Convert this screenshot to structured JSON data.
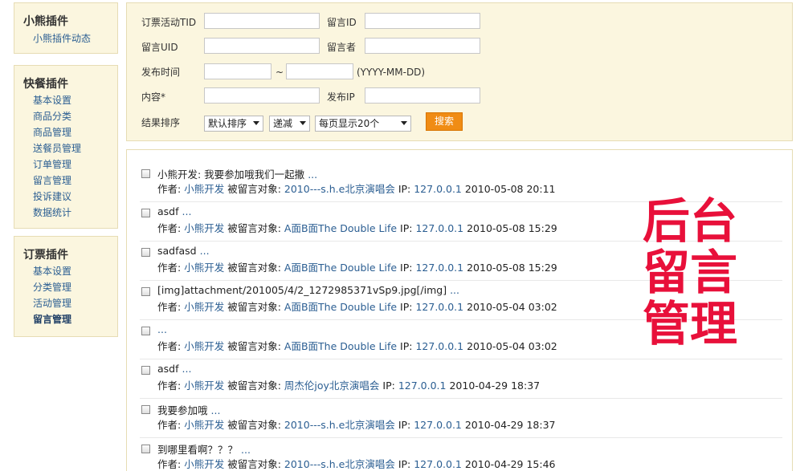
{
  "sidebar": {
    "sections": [
      {
        "title": "小熊插件",
        "items": [
          {
            "label": "小熊插件动态"
          }
        ]
      },
      {
        "title": "快餐插件",
        "items": [
          {
            "label": "基本设置"
          },
          {
            "label": "商品分类"
          },
          {
            "label": "商品管理"
          },
          {
            "label": "送餐员管理"
          },
          {
            "label": "订单管理"
          },
          {
            "label": "留言管理"
          },
          {
            "label": "投诉建议"
          },
          {
            "label": "数据统计"
          }
        ]
      },
      {
        "title": "订票插件",
        "items": [
          {
            "label": "基本设置"
          },
          {
            "label": "分类管理"
          },
          {
            "label": "活动管理"
          },
          {
            "label": "留言管理",
            "active": true
          }
        ]
      }
    ]
  },
  "filter": {
    "tid_label": "订票活动TID",
    "comment_id_label": "留言ID",
    "uid_label": "留言UID",
    "author_label": "留言者",
    "time_label": "发布时间",
    "time_sep": "~",
    "time_hint": "(YYYY-MM-DD)",
    "content_label": "内容*",
    "ip_label": "发布IP",
    "sort_label": "结果排序",
    "sort_order": "默认排序",
    "sort_dir": "递减",
    "per_page": "每页显示20个",
    "search_button": "搜索"
  },
  "list": {
    "author_prefix": "作者:",
    "target_prefix": "被留言对象:",
    "ip_prefix": "IP:",
    "rows": [
      {
        "title": "小熊开发: 我要参加哦我们一起撒",
        "author": "小熊开发",
        "target": "2010---s.h.e北京演唱会",
        "ip": "127.0.0.1",
        "time": "2010-05-08 20:11"
      },
      {
        "title": "asdf",
        "author": "小熊开发",
        "target": "A面B面The Double Life",
        "ip": "127.0.0.1",
        "time": "2010-05-08 15:29"
      },
      {
        "title": "sadfasd",
        "author": "小熊开发",
        "target": "A面B面The Double Life",
        "ip": "127.0.0.1",
        "time": "2010-05-08 15:29"
      },
      {
        "title": "[img]attachment/201005/4/2_1272985371vSp9.jpg[/img]",
        "author": "小熊开发",
        "target": "A面B面The Double Life",
        "ip": "127.0.0.1",
        "time": "2010-05-04 03:02"
      },
      {
        "title": "",
        "author": "小熊开发",
        "target": "A面B面The Double Life",
        "ip": "127.0.0.1",
        "time": "2010-05-04 03:02"
      },
      {
        "title": "asdf",
        "author": "小熊开发",
        "target": "周杰伦joy北京演唱会",
        "ip": "127.0.0.1",
        "time": "2010-04-29 18:37"
      },
      {
        "title": "我要参加哦",
        "author": "小熊开发",
        "target": "2010---s.h.e北京演唱会",
        "ip": "127.0.0.1",
        "time": "2010-04-29 18:37"
      },
      {
        "title": "到哪里看啊？？？",
        "author": "小熊开发",
        "target": "2010---s.h.e北京演唱会",
        "ip": "127.0.0.1",
        "time": "2010-04-29 15:46"
      }
    ],
    "more_text": "..."
  },
  "overlay": {
    "line1": "后台",
    "line2": "留言",
    "line3": "管理"
  },
  "colors": {
    "accent": "#f08c14",
    "link": "#2b5e92",
    "panel_bg": "#fbf6df",
    "overlay": "#e8103a"
  }
}
